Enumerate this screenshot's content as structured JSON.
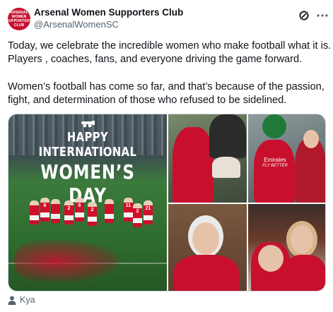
{
  "account": {
    "name": "Arsenal Women Supporters Club",
    "handle": "@ArsenalWomenSC",
    "avatar_text": [
      "ARSENAL WOMEN",
      "SUPPORTERS CLUB"
    ]
  },
  "tweet": {
    "paragraph1": [
      "Today, we celebrate the incredible women who make football what it is.",
      "Players , coaches, fans, and everyone driving the game forward."
    ],
    "paragraph2": [
      "Women’s football has come so far, and that’s because of the passion,",
      "fight, and determination of those who refused to be sidelined."
    ]
  },
  "media": {
    "main_image": {
      "line1": "HAPPY INTERNATIONAL",
      "line2": "WOMEN’S DAY",
      "shirt_numbers": [
        "6",
        "2",
        "6",
        "2",
        "11",
        "2",
        "21"
      ]
    },
    "shirt_sponsor": [
      "Emirates",
      "FLY BETTER"
    ]
  },
  "footer": {
    "tagged": "Kya"
  },
  "icons": {
    "grok": "grok-icon",
    "more": "more-icon",
    "person": "person-icon"
  },
  "colors": {
    "arsenal_red": "#c8102e",
    "text": "#0f1419",
    "muted": "#536471"
  }
}
